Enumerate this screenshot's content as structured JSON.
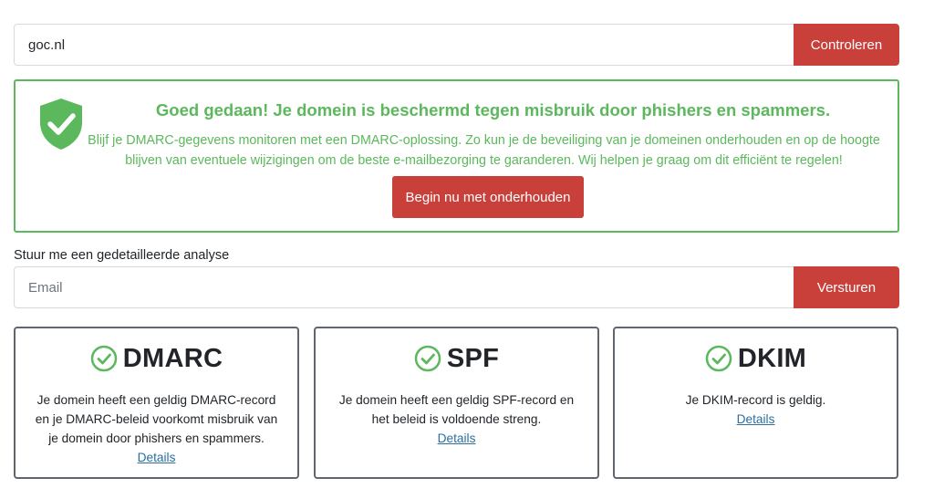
{
  "domain_form": {
    "value": "goc.nl",
    "button_label": "Controleren"
  },
  "success": {
    "title": "Goed gedaan! Je domein is beschermd tegen misbruik door phishers en spammers.",
    "body": "Blijf je DMARC-gegevens monitoren met een DMARC-oplossing. Zo kun je de beveiliging van je domeinen onderhouden en op de hoogte blijven van eventuele wijzigingen om de beste e-mailbezorging te garanderen. Wij helpen je graag om dit efficiënt te regelen!",
    "button_label": "Begin nu met onderhouden",
    "icon": "shield-check-icon"
  },
  "analysis": {
    "label": "Stuur me een gedetailleerde analyse",
    "email_placeholder": "Email",
    "button_label": "Versturen"
  },
  "cards": [
    {
      "name": "DMARC",
      "description": "Je domein heeft een geldig DMARC-record en je DMARC-beleid voorkomt misbruik van je domein door phishers en spammers.",
      "link": "Details"
    },
    {
      "name": "SPF",
      "description": "Je domein heeft een geldig SPF-record en het beleid is voldoende streng.",
      "link": "Details"
    },
    {
      "name": "DKIM",
      "description": "Je DKIM-record is geldig.",
      "link": "Details"
    }
  ],
  "colors": {
    "accent_red": "#c9403b",
    "success_green": "#5cb85c",
    "link_blue": "#2a6f9e",
    "card_border": "#5f6670"
  }
}
